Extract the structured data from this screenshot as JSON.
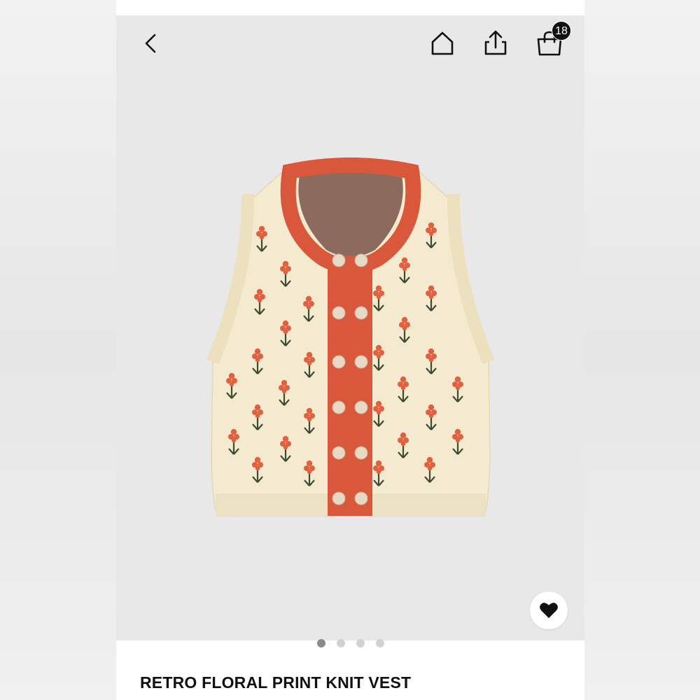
{
  "header": {
    "back_icon": "chevron-left-icon",
    "home_icon": "home-icon",
    "share_icon": "share-icon",
    "bag_icon": "shopping-bag-icon",
    "cart_count": "18"
  },
  "product": {
    "title": "RETRO FLORAL PRINT KNIT VEST",
    "image_subject": "knit-vest-illustration",
    "colors": {
      "knit": "#f3ead0",
      "trim": "#d9573a",
      "flower": "#e0603f",
      "stem": "#3d4a34",
      "button": "#e8d9c6"
    }
  },
  "gallery": {
    "page_count": 4,
    "active_index": 0,
    "favorite_icon": "heart-icon",
    "background": "#e8e8e8"
  }
}
